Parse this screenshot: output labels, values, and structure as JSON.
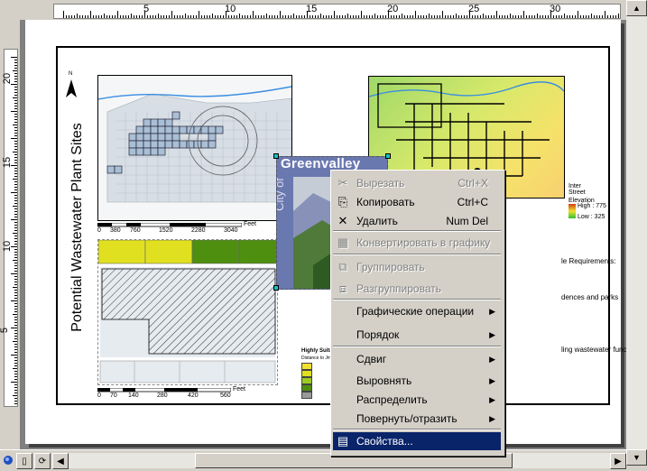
{
  "ruler_h": {
    "labels": [
      "5",
      "10",
      "15",
      "20",
      "25",
      "30"
    ]
  },
  "ruler_v": {
    "labels": [
      "20",
      "15",
      "10",
      "5"
    ]
  },
  "layout": {
    "title": "Potential Wastewater Plant Sites",
    "north_label": "N",
    "logo_text": "Greenvalley",
    "logo_sub": "City of",
    "scale1": [
      "0",
      "380",
      "760",
      "1520",
      "2280",
      "3040"
    ],
    "scale1_unit": "Feet",
    "scale2": [
      "0",
      "70",
      "140",
      "280",
      "420",
      "560"
    ],
    "scale2_unit": "Feet",
    "req_title": "le Requirements:",
    "req_line1": "dences and parks",
    "req_line2": "ling wastewater function",
    "suit_title": "Highly Suitab",
    "suit_sub": "Distance to Jmp",
    "legend_right": [
      "Elevation",
      "High : 775",
      "Low : 325"
    ],
    "legend_right_top": [
      "Inter",
      "Street"
    ]
  },
  "context_menu": {
    "items": [
      {
        "label": "Вырезать",
        "shortcut": "Ctrl+X",
        "icon": "scissors-icon",
        "glyph": "✂",
        "disabled": true
      },
      {
        "label": "Копировать",
        "shortcut": "Ctrl+C",
        "icon": "copy-icon",
        "glyph": "⎘",
        "disabled": false
      },
      {
        "label": "Удалить",
        "shortcut": "Num Del",
        "icon": "delete-x-icon",
        "glyph": "✕",
        "disabled": false
      },
      {
        "label": "Конвертировать в графику",
        "shortcut": "",
        "icon": "convert-graphics-icon",
        "glyph": "▦",
        "disabled": true
      },
      {
        "label": "Группировать",
        "shortcut": "",
        "icon": "group-icon",
        "glyph": "⧉",
        "disabled": true
      },
      {
        "label": "Разгруппировать",
        "shortcut": "",
        "icon": "ungroup-icon",
        "glyph": "⧈",
        "disabled": true
      },
      {
        "label": "Графические операции",
        "submenu": true,
        "disabled": false
      },
      {
        "label": "Порядок",
        "submenu": true,
        "disabled": false
      },
      {
        "label": "Сдвиг",
        "submenu": true,
        "disabled": false
      },
      {
        "label": "Выровнять",
        "submenu": true,
        "disabled": false
      },
      {
        "label": "Распределить",
        "submenu": true,
        "disabled": false
      },
      {
        "label": "Повернуть/отразить",
        "submenu": true,
        "disabled": false
      },
      {
        "label": "Свойства...",
        "shortcut": "",
        "icon": "properties-icon",
        "glyph": "▤",
        "disabled": false,
        "selected": true
      }
    ]
  },
  "colors": {
    "selection": "#0a246a",
    "handle": "#19c0c0",
    "parcel_blue": "#a9bfd6",
    "suit_high": "#4f8f10",
    "suit_mid": "#9ccc20",
    "suit_low": "#e0e020"
  }
}
